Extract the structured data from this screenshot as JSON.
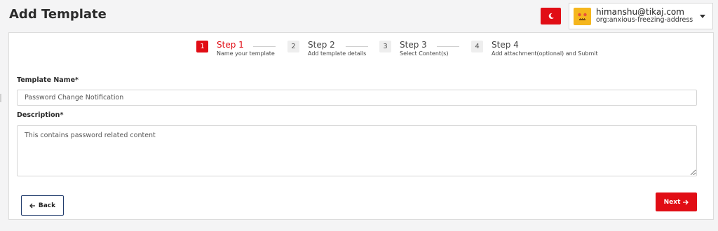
{
  "page": {
    "title": "Add Template"
  },
  "header": {
    "theme_icon": "moon-icon",
    "user": {
      "email": "himanshu@tikaj.com",
      "org": "org:anxious-freezing-address",
      "avatar_icon": "robot-avatar-icon"
    }
  },
  "colors": {
    "accent": "#e10d15",
    "back_border": "#1f3a6b",
    "avatar": "#f5b61d"
  },
  "stepper": {
    "steps": [
      {
        "number": "1",
        "title": "Step 1",
        "subtitle": "Name your template"
      },
      {
        "number": "2",
        "title": "Step 2",
        "subtitle": "Add template details"
      },
      {
        "number": "3",
        "title": "Step 3",
        "subtitle": "Select Content(s)"
      },
      {
        "number": "4",
        "title": "Step 4",
        "subtitle": "Add attachment(optional) and Submit"
      }
    ],
    "active_step": 1
  },
  "form": {
    "template_name_label": "Template Name*",
    "template_name_value": "Password Change Notification",
    "description_label": "Description*",
    "description_value": "This contains password related content"
  },
  "buttons": {
    "back": "Back",
    "next": "Next"
  }
}
